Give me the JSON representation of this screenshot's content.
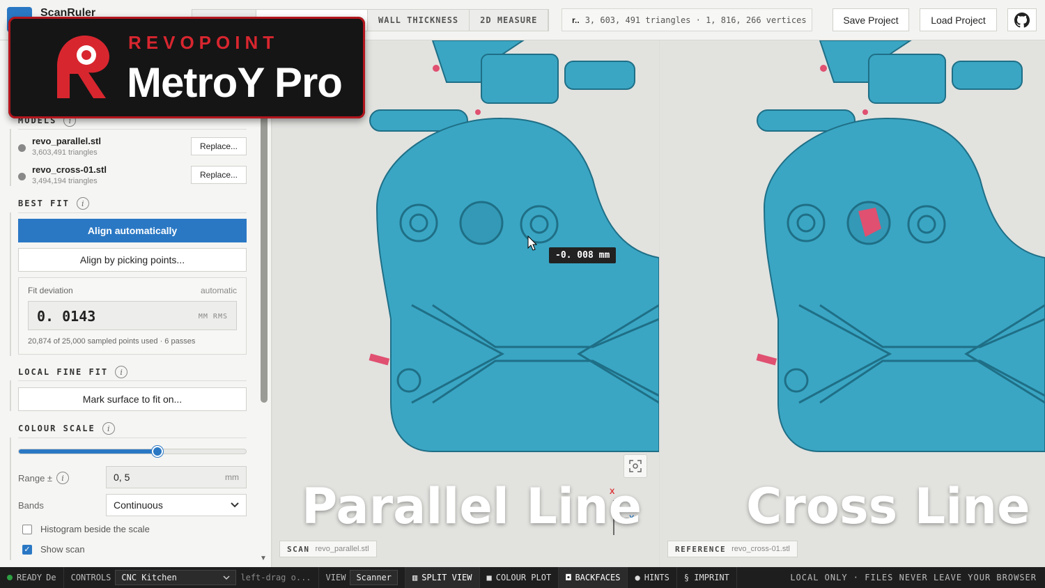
{
  "app": {
    "title": "ScanRuler"
  },
  "header": {
    "tabs": [
      {
        "label": ""
      },
      {
        "label": ""
      },
      {
        "label": "WALL THICKNESS"
      },
      {
        "label": "2D MEASURE"
      }
    ],
    "mesh_name": "r..",
    "mesh_stats": "3, 603, 491 triangles · 1, 816, 266 vertices",
    "save_label": "Save Project",
    "load_label": "Load Project",
    "github_icon": "github-icon"
  },
  "brand": {
    "subtitle": "REVOPOINT",
    "title": "MetroY Pro"
  },
  "sidebar": {
    "models_heading": "MODELS",
    "models": [
      {
        "name": "revo_parallel.stl",
        "triangles": "3,603,491 triangles",
        "action": "Replace..."
      },
      {
        "name": "revo_cross-01.stl",
        "triangles": "3,494,194 triangles",
        "action": "Replace..."
      }
    ],
    "best_fit": {
      "heading": "BEST FIT",
      "align_auto": "Align automatically",
      "align_pick": "Align by picking points...",
      "deviation_label": "Fit deviation",
      "deviation_mode": "automatic",
      "deviation_value": "0. 0143",
      "deviation_unit": "MM RMS",
      "note": "20,874 of 25,000 sampled points used · 6 passes"
    },
    "local_fit": {
      "heading": "LOCAL FINE FIT",
      "mark_surface": "Mark surface to fit on..."
    },
    "colour_scale": {
      "heading": "COLOUR SCALE",
      "slider_fraction": 0.61,
      "range_label": "Range ±",
      "range_value": "0, 5",
      "range_unit": "mm",
      "bands_label": "Bands",
      "bands_value": "Continuous",
      "histogram_label": "Histogram beside the scale",
      "histogram_checked": false,
      "show_scan_label": "Show scan",
      "show_scan_checked": true
    }
  },
  "viewports": {
    "left": {
      "caption": "Parallel Line",
      "tag_kind": "SCAN",
      "tag_file": "revo_parallel.stl",
      "measurement": "-0. 008  mm",
      "axis_x": "X",
      "axis_y": "Y"
    },
    "right": {
      "caption": "Cross Line",
      "tag_kind": "REFERENCE",
      "tag_file": "revo_cross-01.stl"
    }
  },
  "statusbar": {
    "ready": "READY",
    "ready_suffix": "De",
    "controls_label": "CONTROLS",
    "controls_value": "CNC Kitchen",
    "hint": "left-drag o...",
    "view_label": "VIEW",
    "view_value": "Scanner",
    "split_view": "SPLIT VIEW",
    "colour_plot": "COLOUR PLOT",
    "backfaces": "BACKFACES",
    "hints": "HINTS",
    "imprint": "§ IMPRINT",
    "local_only": "LOCAL ONLY · FILES NEVER LEAVE YOUR BROWSER"
  },
  "colors": {
    "accent": "#2a78c4",
    "model": "#3aa6c4",
    "brand_red": "#d8262f"
  }
}
